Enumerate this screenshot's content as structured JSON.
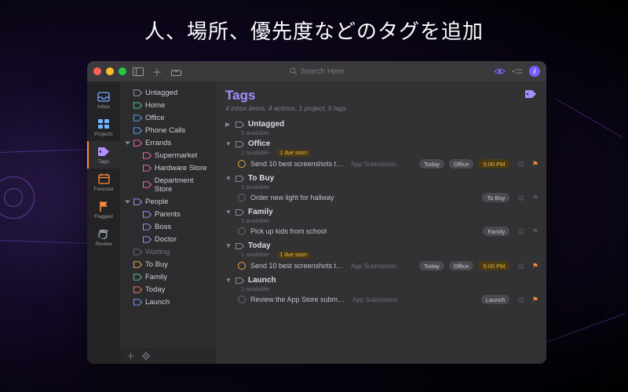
{
  "headline": "人、場所、優先度などのタグを追加",
  "search": {
    "placeholder": "Search Here"
  },
  "rail": [
    {
      "id": "inbox",
      "label": "Inbox",
      "color": "#7aa6ff"
    },
    {
      "id": "projects",
      "label": "Projects",
      "color": "#6fb8ff"
    },
    {
      "id": "tags",
      "label": "Tags",
      "color": "#b490ff"
    },
    {
      "id": "forecast",
      "label": "Forecast",
      "color": "#ff8a3d"
    },
    {
      "id": "flagged",
      "label": "Flagged",
      "color": "#ff8a3d"
    },
    {
      "id": "review",
      "label": "Review",
      "color": "#9aa6b2"
    }
  ],
  "sidebar": {
    "items": [
      {
        "label": "Untagged",
        "color": "#9aa0a8",
        "level": 0,
        "disc": false
      },
      {
        "label": "Home",
        "color": "#5ec8a0",
        "level": 0,
        "disc": false
      },
      {
        "label": "Office",
        "color": "#5aa7ff",
        "level": 0,
        "disc": false
      },
      {
        "label": "Phone Calls",
        "color": "#5aa7ff",
        "level": 0,
        "disc": false
      },
      {
        "label": "Errands",
        "color": "#ff6aa8",
        "level": 0,
        "disc": true
      },
      {
        "label": "Supermarket",
        "color": "#ff6aa8",
        "level": 1,
        "disc": false
      },
      {
        "label": "Hardware Store",
        "color": "#ff6aa8",
        "level": 1,
        "disc": false
      },
      {
        "label": "Department Store",
        "color": "#ff6aa8",
        "level": 1,
        "disc": false
      },
      {
        "label": "People",
        "color": "#b490ff",
        "level": 0,
        "disc": true
      },
      {
        "label": "Parents",
        "color": "#b490ff",
        "level": 1,
        "disc": false
      },
      {
        "label": "Boss",
        "color": "#b490ff",
        "level": 1,
        "disc": false
      },
      {
        "label": "Doctor",
        "color": "#b490ff",
        "level": 1,
        "disc": false
      },
      {
        "label": "Waiting",
        "color": "#6e6e76",
        "level": 0,
        "disc": false,
        "waiting": true
      },
      {
        "label": "To Buy",
        "color": "#ffb457",
        "level": 0,
        "disc": false
      },
      {
        "label": "Family",
        "color": "#5ec8a0",
        "level": 0,
        "disc": false
      },
      {
        "label": "Today",
        "color": "#ff7a57",
        "level": 0,
        "disc": false
      },
      {
        "label": "Launch",
        "color": "#7aa6ff",
        "level": 0,
        "disc": false
      }
    ]
  },
  "main": {
    "title": "Tags",
    "subtitle": "4 inbox items, 4 actions, 1 project, 5 tags",
    "groups": [
      {
        "name": "Untagged",
        "open": false,
        "sub": "5 available",
        "tasks": []
      },
      {
        "name": "Office",
        "open": true,
        "sub": "1 available",
        "due": "1 due soon",
        "tasks": [
          {
            "title": "Send 10 best screenshots t…",
            "project": "App Submission",
            "soon": true,
            "chips": [
              "Today",
              "Office"
            ],
            "time": "5:00 PM",
            "flag": true
          }
        ]
      },
      {
        "name": "To Buy",
        "open": true,
        "sub": "1 available",
        "tasks": [
          {
            "title": "Order new light for hallway",
            "chips": [
              "To Buy"
            ]
          }
        ]
      },
      {
        "name": "Family",
        "open": true,
        "sub": "1 available",
        "tasks": [
          {
            "title": "Pick up kids from school",
            "chips": [
              "Family"
            ]
          }
        ]
      },
      {
        "name": "Today",
        "open": true,
        "sub": "1 available",
        "due": "1 due soon",
        "tasks": [
          {
            "title": "Send 10 best screenshots t…",
            "project": "App Submission",
            "soon": true,
            "chips": [
              "Today",
              "Office"
            ],
            "time": "5:00 PM",
            "flag": true
          }
        ]
      },
      {
        "name": "Launch",
        "open": true,
        "sub": "1 available",
        "tasks": [
          {
            "title": "Review the App Store subm…",
            "project": "App Submission",
            "chips": [
              "Launch"
            ],
            "flag": true
          }
        ]
      }
    ]
  }
}
